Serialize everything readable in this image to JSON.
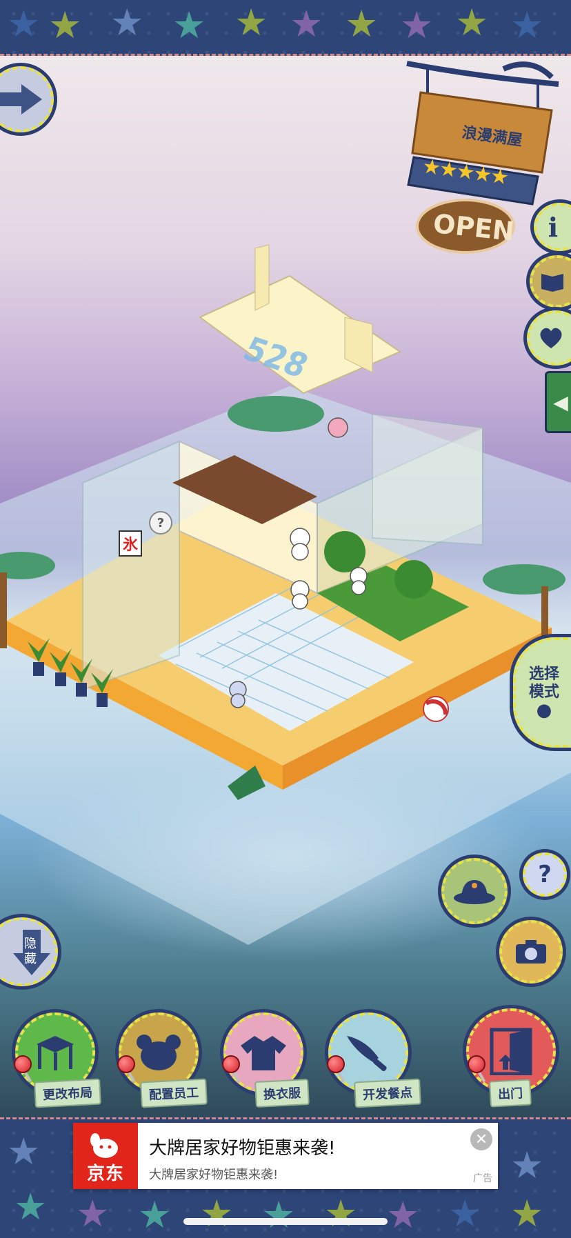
{
  "sign": {
    "shop_name": "浪漫满屋",
    "stars": 5,
    "open_label": "OPEN"
  },
  "room_number": "528",
  "shop_sign_char": "氷",
  "side_buttons": {
    "mode_label_line1": "选择",
    "mode_label_line2": "模式",
    "hide_label_line1": "隐",
    "hide_label_line2": "藏"
  },
  "bottom_menu": [
    {
      "label": "更改布局",
      "icon": "table-icon",
      "color": "#5fb84a"
    },
    {
      "label": "配置员工",
      "icon": "bear-head-icon",
      "color": "#c8a44a"
    },
    {
      "label": "换衣服",
      "icon": "shirt-icon",
      "color": "#e7a7bf"
    },
    {
      "label": "开发餐点",
      "icon": "knife-icon",
      "color": "#a7d3df"
    },
    {
      "label": "出门",
      "icon": "door-icon",
      "color": "#e35a5a"
    }
  ],
  "ad": {
    "brand": "京东",
    "title": "大牌居家好物钜惠来袭!",
    "subtitle": "大牌居家好物钜惠来袭!",
    "tag": "广告",
    "close_label": "✕"
  }
}
